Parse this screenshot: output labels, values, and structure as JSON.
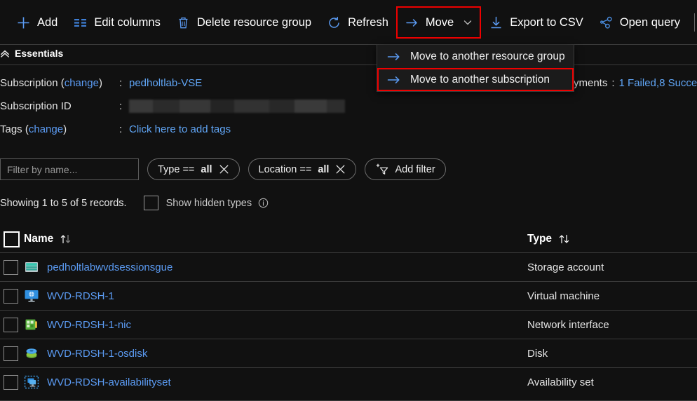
{
  "toolbar": {
    "items": [
      {
        "label": "Add",
        "icon": "plus-icon"
      },
      {
        "label": "Edit columns",
        "icon": "edit-columns-icon"
      },
      {
        "label": "Delete resource group",
        "icon": "trash-icon"
      },
      {
        "label": "Refresh",
        "icon": "refresh-icon"
      },
      {
        "label": "Move",
        "icon": "move-arrow-icon"
      },
      {
        "label": "Export to CSV",
        "icon": "download-icon"
      },
      {
        "label": "Open query",
        "icon": "open-query-icon"
      }
    ],
    "add_label": "Add",
    "edit_columns_label": "Edit columns",
    "delete_rg_label": "Delete resource group",
    "refresh_label": "Refresh",
    "move_label": "Move",
    "export_csv_label": "Export to CSV",
    "open_query_label": "Open query"
  },
  "move_menu": {
    "items": [
      {
        "label": "Move to another resource group",
        "highlighted": false
      },
      {
        "label": "Move to another subscription",
        "highlighted": true
      }
    ],
    "item_0_label": "Move to another resource group",
    "item_1_label": "Move to another subscription"
  },
  "essentials": {
    "title": "Essentials",
    "subscription_key": "Subscription",
    "subscription_change": "change",
    "subscription_value": "pedholtlab-VSE",
    "subscription_id_key": "Subscription ID",
    "subscription_id_value": "",
    "tags_key": "Tags",
    "tags_change": "change",
    "tags_value": "Click here to add tags",
    "colon": ":",
    "open_paren": "(",
    "close_paren": ")",
    "deployments_key": "yments",
    "deployments_value": "1 Failed,8 Succe"
  },
  "filters": {
    "name_placeholder": "Filter by name...",
    "name_value": "",
    "type_pill_prefix": "Type ==",
    "type_pill_value": "all",
    "location_pill_prefix": "Location ==",
    "location_pill_value": "all",
    "add_filter_label": "Add filter"
  },
  "records": {
    "showing_text": "Showing 1 to 5 of 5 records.",
    "show_hidden_label": "Show hidden types"
  },
  "table": {
    "columns": {
      "name": "Name",
      "type": "Type"
    },
    "rows": [
      {
        "name": "pedholtlabwvdsessionsgue",
        "type": "Storage account",
        "icon": "storage-account-icon"
      },
      {
        "name": "WVD-RDSH-1",
        "type": "Virtual machine",
        "icon": "virtual-machine-icon"
      },
      {
        "name": "WVD-RDSH-1-nic",
        "type": "Network interface",
        "icon": "network-interface-icon"
      },
      {
        "name": "WVD-RDSH-1-osdisk",
        "type": "Disk",
        "icon": "disk-icon"
      },
      {
        "name": "WVD-RDSH-availabilityset",
        "type": "Availability set",
        "icon": "availability-set-icon"
      }
    ]
  },
  "colors": {
    "background": "#111111",
    "accent_link": "#5b9bf3",
    "highlight_box": "#ee0000",
    "divider": "#3b3b3b",
    "menu_background": "#1b1b1b"
  }
}
